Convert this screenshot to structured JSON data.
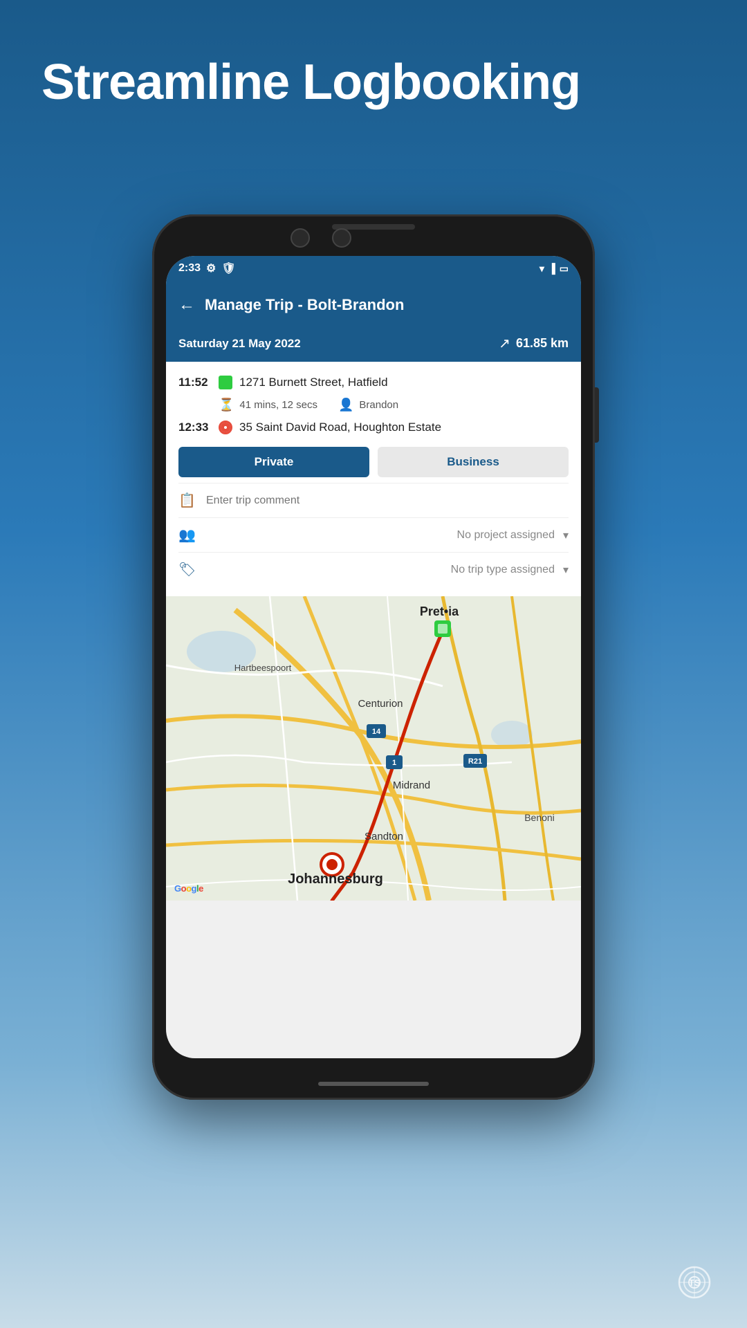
{
  "headline": "Streamline Logbooking",
  "status_bar": {
    "time": "2:33",
    "wifi_icon": "wifi",
    "signal_icon": "signal",
    "battery_icon": "battery"
  },
  "header": {
    "title": "Manage Trip - Bolt-Brandon",
    "back_label": "←"
  },
  "trip": {
    "date": "Saturday 21 May 2022",
    "distance": "61.85 km",
    "start_time": "11:52",
    "start_address": "1271 Burnett Street, Hatfield",
    "duration": "41 mins, 12 secs",
    "driver": "Brandon",
    "end_time": "12:33",
    "end_address": "35 Saint David Road, Houghton Estate"
  },
  "buttons": {
    "private": "Private",
    "business": "Business"
  },
  "fields": {
    "comment_placeholder": "Enter trip comment",
    "project_label": "No project assigned",
    "trip_type_label": "No trip type assigned"
  },
  "map": {
    "city_start": "Pretoria",
    "city_via1": "Centurion",
    "city_via2": "Midrand",
    "city_via3": "Sandton",
    "city_end": "Johannesburg",
    "city_left": "Hartbeespoort",
    "city_right": "Benoni",
    "road1": "14",
    "road2": "1",
    "road3": "R21"
  },
  "branding": {
    "google_logo": "Google",
    "ts_label": "TS"
  }
}
